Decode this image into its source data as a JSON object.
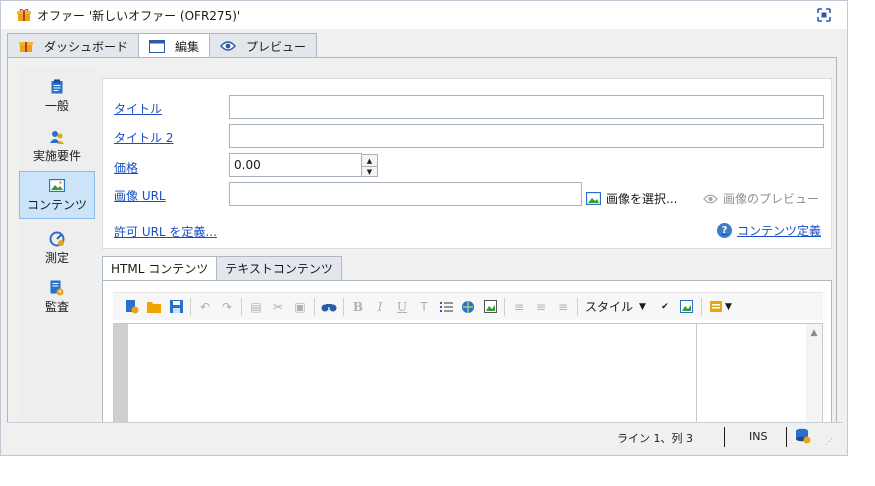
{
  "window": {
    "title": "オファー '新しいオファー (OFR275)'",
    "title_icon": "gift-icon",
    "maximize_icon": "maximize-icon"
  },
  "tabs": [
    {
      "label": "ダッシュボード",
      "icon": "gift-icon",
      "active": false
    },
    {
      "label": "編集",
      "icon": "window-icon",
      "active": true
    },
    {
      "label": "プレビュー",
      "icon": "eye-icon",
      "active": false
    }
  ],
  "sidebar": {
    "items": [
      {
        "label": "一般",
        "icon": "clipboard-icon",
        "selected": false
      },
      {
        "label": "実施要件",
        "icon": "users-icon",
        "selected": false
      },
      {
        "label": "コンテンツ",
        "icon": "image-icon",
        "selected": true
      },
      {
        "label": "測定",
        "icon": "gauge-icon",
        "selected": false
      },
      {
        "label": "監査",
        "icon": "audit-icon",
        "selected": false
      }
    ]
  },
  "form": {
    "title_label": "タイトル",
    "title_value": "",
    "title2_label": "タイトル 2",
    "title2_value": "",
    "price_label": "価格",
    "price_value": "0.00",
    "image_url_label": "画像 URL",
    "image_url_value": "",
    "select_image_label": "画像を選択...",
    "preview_image_label": "画像のプレビュー",
    "allowed_url_link": "許可 URL を定義...",
    "content_definition_link": "コンテンツ定義"
  },
  "content_tabs": [
    {
      "label": "HTML コンテンツ",
      "active": true
    },
    {
      "label": "テキストコンテンツ",
      "active": false
    }
  ],
  "toolbar": {
    "style_label": "スタイル",
    "buttons": [
      "new-icon",
      "open-folder-icon",
      "save-icon",
      "undo-icon",
      "redo-icon",
      "paste-icon",
      "cut-icon",
      "paste-special-icon",
      "find-icon",
      "bold-icon",
      "italic-icon",
      "underline-icon",
      "text-format-icon",
      "list-icon",
      "link-icon",
      "insert-image-icon",
      "align-left-icon",
      "align-center-icon",
      "align-right-icon",
      "spellcheck-icon",
      "image-edit-icon",
      "view-menu-icon"
    ]
  },
  "status": {
    "position": "ライン 1、列 3",
    "mode": "INS"
  },
  "colors": {
    "link": "#1a4fc4",
    "selected_bg": "#cce4fa",
    "accent": "#3d7dc8",
    "icon_gold": "#e8a317"
  }
}
